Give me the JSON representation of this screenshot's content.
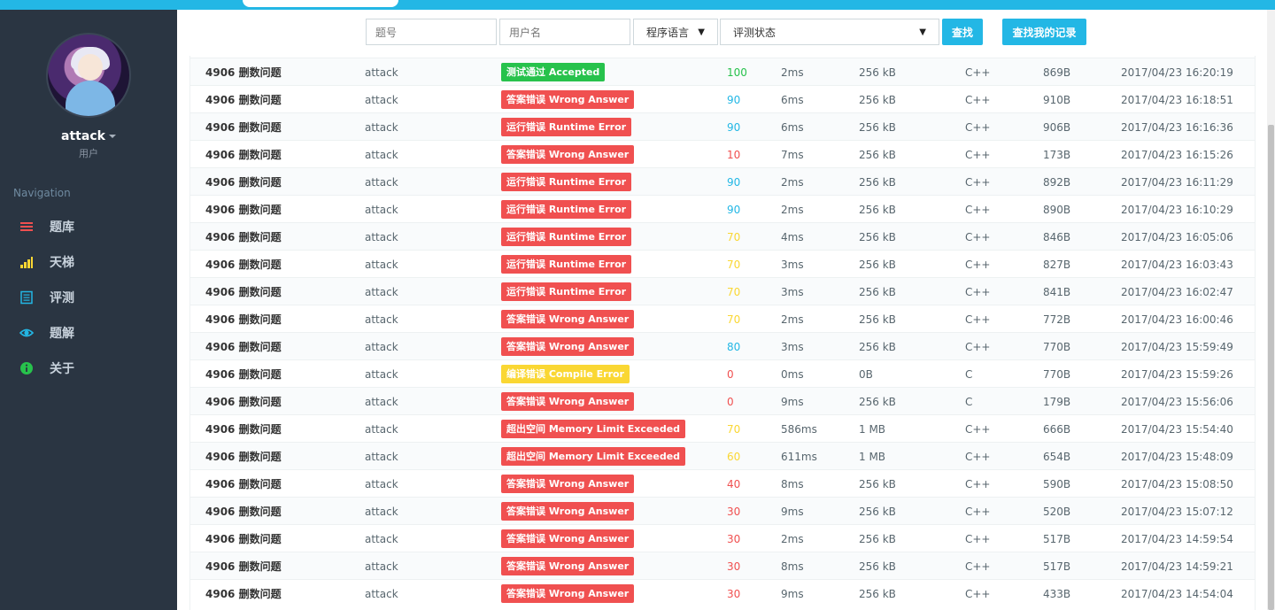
{
  "sidebar": {
    "username": "attack",
    "role": "用户",
    "nav_heading": "Navigation",
    "items": [
      {
        "label": "题库",
        "icon": "list-icon",
        "color": "#f05050"
      },
      {
        "label": "天梯",
        "icon": "bar-chart-icon",
        "color": "#fad733"
      },
      {
        "label": "评测",
        "icon": "document-icon",
        "color": "#23b7e5"
      },
      {
        "label": "题解",
        "icon": "eye-icon",
        "color": "#23b7e5"
      },
      {
        "label": "关于",
        "icon": "info-icon",
        "color": "#27c24c"
      }
    ]
  },
  "filters": {
    "problem_placeholder": "题号",
    "username_placeholder": "用户名",
    "language_label": "程序语言",
    "status_label": "评测状态",
    "search_label": "查找",
    "my_records_label": "查找我的记录"
  },
  "colors": {
    "accent": "#23b7e5",
    "accepted": "#27c24c",
    "error": "#f05050",
    "compile": "#fad733",
    "score_green": "#27c24c",
    "score_blue": "#23b7e5",
    "score_orange": "#fad733",
    "score_red": "#f05050"
  },
  "records": [
    {
      "problem": "4906 删数问题",
      "user": "attack",
      "status": "测试通过 Accepted",
      "status_type": "accepted",
      "score": "100",
      "score_color": "green",
      "time": "2ms",
      "memory": "256 kB",
      "lang": "C++",
      "length": "869B",
      "date": "2017/04/23 16:20:19"
    },
    {
      "problem": "4906 删数问题",
      "user": "attack",
      "status": "答案错误 Wrong Answer",
      "status_type": "error",
      "score": "90",
      "score_color": "blue",
      "time": "6ms",
      "memory": "256 kB",
      "lang": "C++",
      "length": "910B",
      "date": "2017/04/23 16:18:51"
    },
    {
      "problem": "4906 删数问题",
      "user": "attack",
      "status": "运行错误 Runtime Error",
      "status_type": "error",
      "score": "90",
      "score_color": "blue",
      "time": "6ms",
      "memory": "256 kB",
      "lang": "C++",
      "length": "906B",
      "date": "2017/04/23 16:16:36"
    },
    {
      "problem": "4906 删数问题",
      "user": "attack",
      "status": "答案错误 Wrong Answer",
      "status_type": "error",
      "score": "10",
      "score_color": "red",
      "time": "7ms",
      "memory": "256 kB",
      "lang": "C++",
      "length": "173B",
      "date": "2017/04/23 16:15:26"
    },
    {
      "problem": "4906 删数问题",
      "user": "attack",
      "status": "运行错误 Runtime Error",
      "status_type": "error",
      "score": "90",
      "score_color": "blue",
      "time": "2ms",
      "memory": "256 kB",
      "lang": "C++",
      "length": "892B",
      "date": "2017/04/23 16:11:29"
    },
    {
      "problem": "4906 删数问题",
      "user": "attack",
      "status": "运行错误 Runtime Error",
      "status_type": "error",
      "score": "90",
      "score_color": "blue",
      "time": "2ms",
      "memory": "256 kB",
      "lang": "C++",
      "length": "890B",
      "date": "2017/04/23 16:10:29"
    },
    {
      "problem": "4906 删数问题",
      "user": "attack",
      "status": "运行错误 Runtime Error",
      "status_type": "error",
      "score": "70",
      "score_color": "orange",
      "time": "4ms",
      "memory": "256 kB",
      "lang": "C++",
      "length": "846B",
      "date": "2017/04/23 16:05:06"
    },
    {
      "problem": "4906 删数问题",
      "user": "attack",
      "status": "运行错误 Runtime Error",
      "status_type": "error",
      "score": "70",
      "score_color": "orange",
      "time": "3ms",
      "memory": "256 kB",
      "lang": "C++",
      "length": "827B",
      "date": "2017/04/23 16:03:43"
    },
    {
      "problem": "4906 删数问题",
      "user": "attack",
      "status": "运行错误 Runtime Error",
      "status_type": "error",
      "score": "70",
      "score_color": "orange",
      "time": "3ms",
      "memory": "256 kB",
      "lang": "C++",
      "length": "841B",
      "date": "2017/04/23 16:02:47"
    },
    {
      "problem": "4906 删数问题",
      "user": "attack",
      "status": "答案错误 Wrong Answer",
      "status_type": "error",
      "score": "70",
      "score_color": "orange",
      "time": "2ms",
      "memory": "256 kB",
      "lang": "C++",
      "length": "772B",
      "date": "2017/04/23 16:00:46"
    },
    {
      "problem": "4906 删数问题",
      "user": "attack",
      "status": "答案错误 Wrong Answer",
      "status_type": "error",
      "score": "80",
      "score_color": "blue",
      "time": "3ms",
      "memory": "256 kB",
      "lang": "C++",
      "length": "770B",
      "date": "2017/04/23 15:59:49"
    },
    {
      "problem": "4906 删数问题",
      "user": "attack",
      "status": "编译错误 Compile Error",
      "status_type": "compile",
      "score": "0",
      "score_color": "red",
      "time": "0ms",
      "memory": "0B",
      "lang": "C",
      "length": "770B",
      "date": "2017/04/23 15:59:26"
    },
    {
      "problem": "4906 删数问题",
      "user": "attack",
      "status": "答案错误 Wrong Answer",
      "status_type": "error",
      "score": "0",
      "score_color": "red",
      "time": "9ms",
      "memory": "256 kB",
      "lang": "C",
      "length": "179B",
      "date": "2017/04/23 15:56:06"
    },
    {
      "problem": "4906 删数问题",
      "user": "attack",
      "status": "超出空间 Memory Limit Exceeded",
      "status_type": "error",
      "score": "70",
      "score_color": "orange",
      "time": "586ms",
      "memory": "1 MB",
      "lang": "C++",
      "length": "666B",
      "date": "2017/04/23 15:54:40"
    },
    {
      "problem": "4906 删数问题",
      "user": "attack",
      "status": "超出空间 Memory Limit Exceeded",
      "status_type": "error",
      "score": "60",
      "score_color": "orange",
      "time": "611ms",
      "memory": "1 MB",
      "lang": "C++",
      "length": "654B",
      "date": "2017/04/23 15:48:09"
    },
    {
      "problem": "4906 删数问题",
      "user": "attack",
      "status": "答案错误 Wrong Answer",
      "status_type": "error",
      "score": "40",
      "score_color": "red",
      "time": "8ms",
      "memory": "256 kB",
      "lang": "C++",
      "length": "590B",
      "date": "2017/04/23 15:08:50"
    },
    {
      "problem": "4906 删数问题",
      "user": "attack",
      "status": "答案错误 Wrong Answer",
      "status_type": "error",
      "score": "30",
      "score_color": "red",
      "time": "9ms",
      "memory": "256 kB",
      "lang": "C++",
      "length": "520B",
      "date": "2017/04/23 15:07:12"
    },
    {
      "problem": "4906 删数问题",
      "user": "attack",
      "status": "答案错误 Wrong Answer",
      "status_type": "error",
      "score": "30",
      "score_color": "red",
      "time": "2ms",
      "memory": "256 kB",
      "lang": "C++",
      "length": "517B",
      "date": "2017/04/23 14:59:54"
    },
    {
      "problem": "4906 删数问题",
      "user": "attack",
      "status": "答案错误 Wrong Answer",
      "status_type": "error",
      "score": "30",
      "score_color": "red",
      "time": "8ms",
      "memory": "256 kB",
      "lang": "C++",
      "length": "517B",
      "date": "2017/04/23 14:59:21"
    },
    {
      "problem": "4906 删数问题",
      "user": "attack",
      "status": "答案错误 Wrong Answer",
      "status_type": "error",
      "score": "30",
      "score_color": "red",
      "time": "9ms",
      "memory": "256 kB",
      "lang": "C++",
      "length": "433B",
      "date": "2017/04/23 14:54:04"
    }
  ]
}
